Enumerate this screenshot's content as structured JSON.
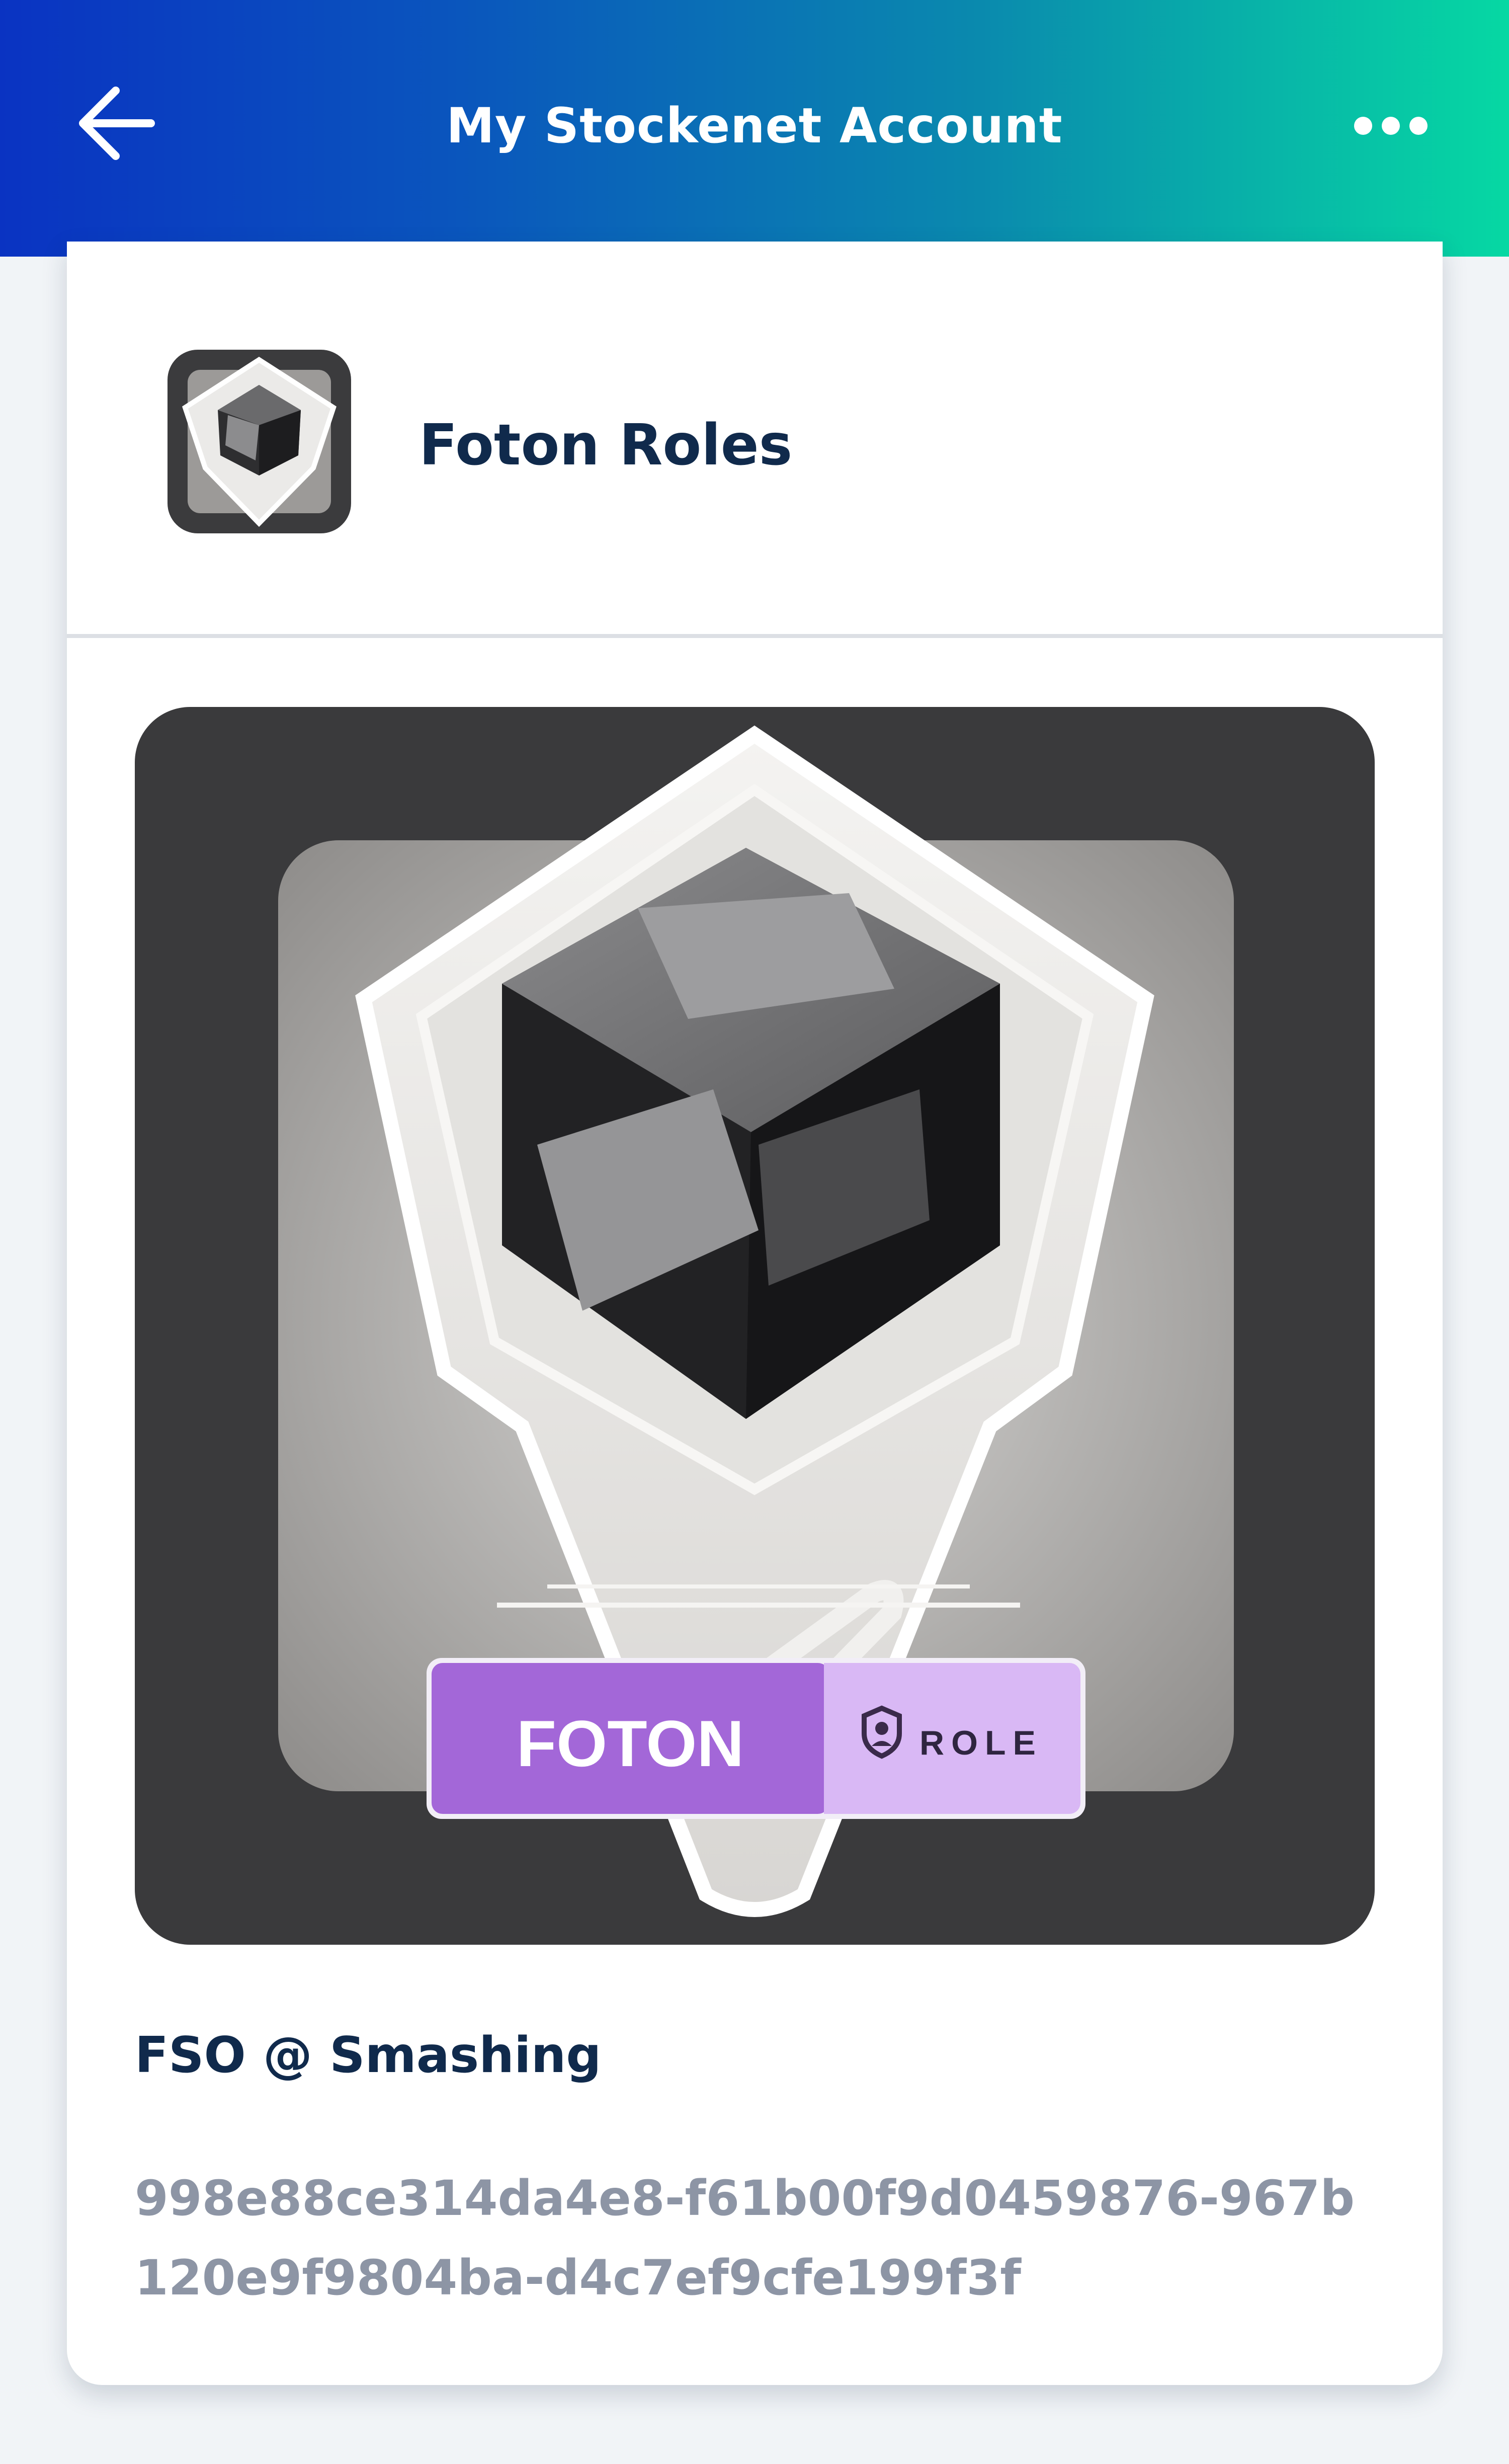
{
  "header": {
    "title": "My Stockenet Account",
    "back_icon": "arrow-left-icon",
    "more_icon": "more-horizontal-icon",
    "gradient_colors": [
      "#0a33c2",
      "#0a8aae",
      "#06d8a3"
    ]
  },
  "collection": {
    "name": "Foton Roles",
    "icon": "foton-gem-icon"
  },
  "nft": {
    "image_badge_brand": "FOTON",
    "image_badge_type": "ROLE",
    "name": "FSO @ Smashing",
    "id": "998e88ce314da4e8-f61b00f9d0459876-967b120e9f9804ba-d4c7ef9cfe199f3f"
  },
  "colors": {
    "title_text": "#102a4c",
    "id_text": "#8d95a5",
    "badge_purple": "#a367d8",
    "badge_lilac": "#d9b8f5"
  }
}
